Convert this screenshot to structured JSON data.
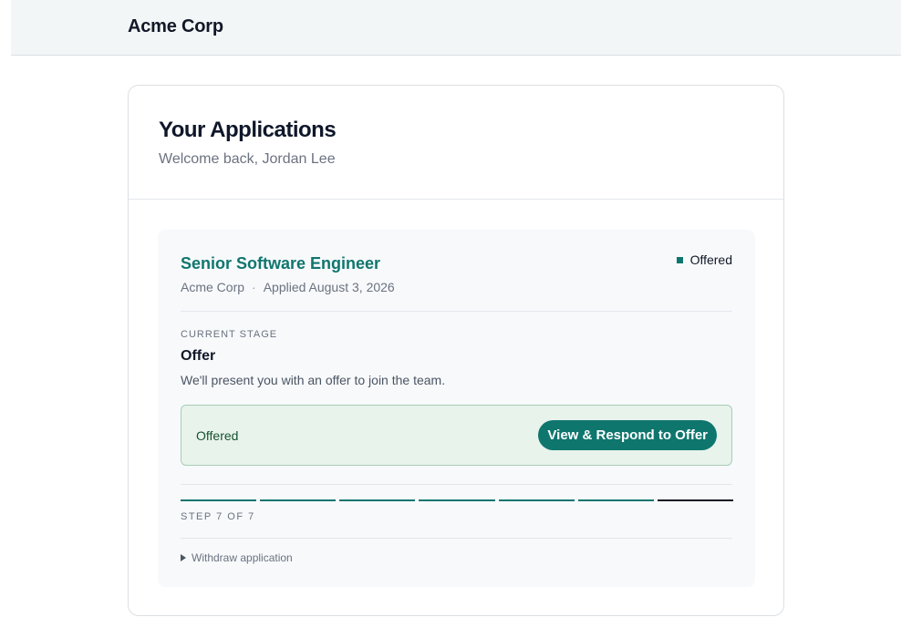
{
  "header": {
    "brand": "Acme Corp"
  },
  "page": {
    "title": "Your Applications",
    "welcome": "Welcome back, Jordan Lee"
  },
  "application": {
    "job_title": "Senior Software Engineer",
    "company": "Acme Corp",
    "separator": "·",
    "applied": "Applied August 3, 2026",
    "status": "Offered",
    "current_stage_label": "CURRENT STAGE",
    "stage_name": "Offer",
    "stage_description": "We'll present you with an offer to join the team.",
    "offer_status": "Offered",
    "offer_button": "View & Respond to Offer",
    "progress": {
      "current_step": 7,
      "total_steps": 7
    },
    "step_label": "STEP 7 OF 7",
    "withdraw_label": "Withdraw application"
  },
  "colors": {
    "accent": "#0f766e",
    "offer_bg": "#e8f3ec",
    "header_bg": "#f3f6f7"
  }
}
